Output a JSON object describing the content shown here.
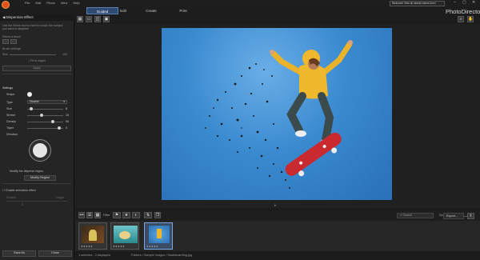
{
  "menu": [
    "File",
    "Edit",
    "Photo",
    "View",
    "Help"
  ],
  "notice": "Welcome! View all tutorial videos here!",
  "window_controls": [
    "–",
    "▢",
    "✕"
  ],
  "left_tabs": [
    "Library",
    "Adjustment"
  ],
  "modes": [
    "Guided",
    "Edit",
    "Create",
    "Print"
  ],
  "active_mode": "Guided",
  "app_name": "PhotoDirector",
  "panel": {
    "title": "Dispersion Effect",
    "intro": "Use the Brush tool to mark to scope the subject you want to disperse",
    "select_brush": "Select a brush",
    "brush_settings": "Brush settings",
    "size_label": "Size",
    "size_value": "100",
    "fit_label": "Fit to edges",
    "apply_label": "Apply",
    "settings_title": "Settings",
    "shape_label": "Shape",
    "type_label": "Type",
    "type_value": "Disable",
    "sliders": [
      {
        "label": "Size",
        "value": "8"
      },
      {
        "label": "Stretch",
        "value": "15"
      },
      {
        "label": "Density",
        "value": "90"
      },
      {
        "label": "Taper",
        "value": "0"
      }
    ],
    "direction_label": "Direction",
    "modify_text": "Modify the disperse region",
    "modify_button": "Modify Region",
    "enable_label": "Enable animation effect",
    "range_left": "Smaller",
    "range_right": "Larger",
    "range_value": "0",
    "save_as": "Save As",
    "close": "Close"
  },
  "toolbar_icons": [
    "grid-view",
    "single-view",
    "compare-view",
    "slideshow"
  ],
  "toolbar_right_icons": [
    "zoom-icon",
    "hand-icon"
  ],
  "bottom": {
    "search_placeholder": "Search",
    "view_label": "Filter",
    "zoom_label": "Zoom",
    "export_label": "Export..."
  },
  "thumbnails": [
    {
      "name": "thumb-1",
      "stars": "★★★★★"
    },
    {
      "name": "thumb-2",
      "stars": "★★★★★"
    },
    {
      "name": "thumb-3",
      "stars": "★★★★★"
    }
  ],
  "status": {
    "selection": "1 selected - 3 displayed",
    "path": "Folders / Sample Images / Skateboarding.jpg"
  }
}
